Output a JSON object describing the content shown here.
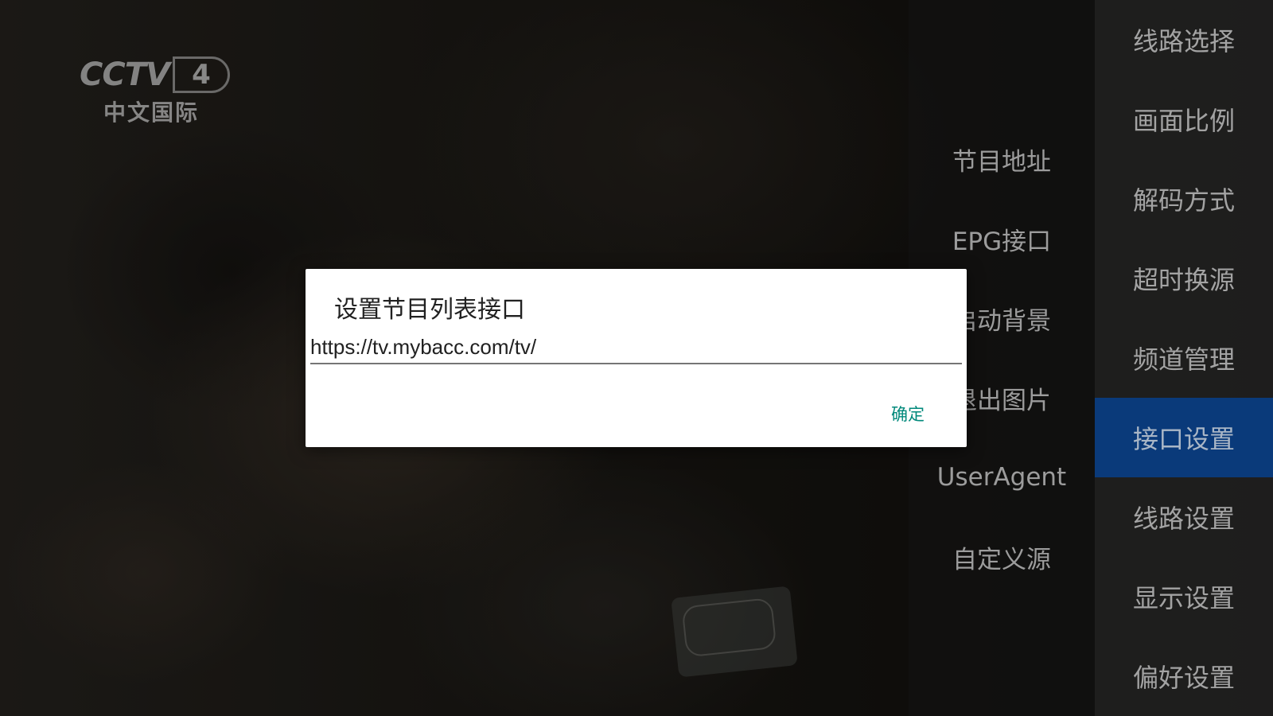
{
  "channel_logo": {
    "brand": "CCTV",
    "number": "4",
    "subtitle": "中文国际"
  },
  "settings_menu": {
    "items": [
      {
        "label": "线路选择"
      },
      {
        "label": "画面比例"
      },
      {
        "label": "解码方式"
      },
      {
        "label": "超时换源"
      },
      {
        "label": "频道管理"
      },
      {
        "label": "接口设置",
        "active": true
      },
      {
        "label": "线路设置"
      },
      {
        "label": "显示设置"
      },
      {
        "label": "偏好设置"
      }
    ]
  },
  "interface_submenu": {
    "items": [
      {
        "label": "节目地址"
      },
      {
        "label": "EPG接口"
      },
      {
        "label": "启动背景"
      },
      {
        "label": "退出图片"
      },
      {
        "label": "UserAgent"
      },
      {
        "label": "自定义源"
      }
    ]
  },
  "dialog": {
    "title": "设置节目列表接口",
    "input_value": "https://tv.mybacc.com/tv/",
    "confirm_label": "确定"
  },
  "colors": {
    "active_menu_bg": "#0a3a7a",
    "confirm_text": "#00897b",
    "menu_text": "#a3a3a3"
  }
}
